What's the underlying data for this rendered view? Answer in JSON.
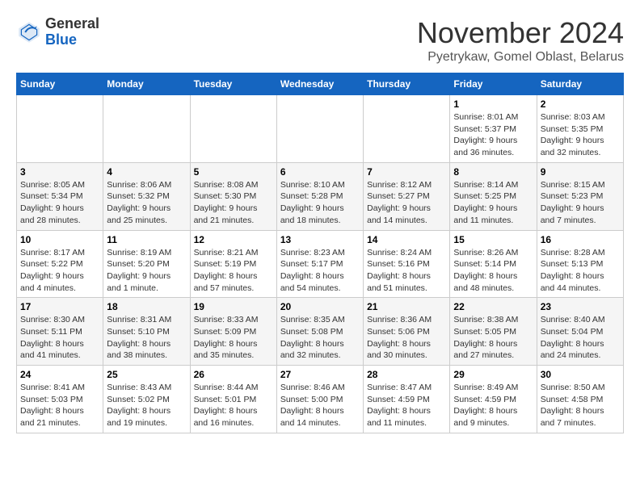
{
  "header": {
    "logo": {
      "line1": "General",
      "line2": "Blue"
    },
    "title": "November 2024",
    "location": "Pyetrykaw, Gomel Oblast, Belarus"
  },
  "weekdays": [
    "Sunday",
    "Monday",
    "Tuesday",
    "Wednesday",
    "Thursday",
    "Friday",
    "Saturday"
  ],
  "weeks": [
    [
      {
        "day": "",
        "info": ""
      },
      {
        "day": "",
        "info": ""
      },
      {
        "day": "",
        "info": ""
      },
      {
        "day": "",
        "info": ""
      },
      {
        "day": "",
        "info": ""
      },
      {
        "day": "1",
        "info": "Sunrise: 8:01 AM\nSunset: 5:37 PM\nDaylight: 9 hours\nand 36 minutes."
      },
      {
        "day": "2",
        "info": "Sunrise: 8:03 AM\nSunset: 5:35 PM\nDaylight: 9 hours\nand 32 minutes."
      }
    ],
    [
      {
        "day": "3",
        "info": "Sunrise: 8:05 AM\nSunset: 5:34 PM\nDaylight: 9 hours\nand 28 minutes."
      },
      {
        "day": "4",
        "info": "Sunrise: 8:06 AM\nSunset: 5:32 PM\nDaylight: 9 hours\nand 25 minutes."
      },
      {
        "day": "5",
        "info": "Sunrise: 8:08 AM\nSunset: 5:30 PM\nDaylight: 9 hours\nand 21 minutes."
      },
      {
        "day": "6",
        "info": "Sunrise: 8:10 AM\nSunset: 5:28 PM\nDaylight: 9 hours\nand 18 minutes."
      },
      {
        "day": "7",
        "info": "Sunrise: 8:12 AM\nSunset: 5:27 PM\nDaylight: 9 hours\nand 14 minutes."
      },
      {
        "day": "8",
        "info": "Sunrise: 8:14 AM\nSunset: 5:25 PM\nDaylight: 9 hours\nand 11 minutes."
      },
      {
        "day": "9",
        "info": "Sunrise: 8:15 AM\nSunset: 5:23 PM\nDaylight: 9 hours\nand 7 minutes."
      }
    ],
    [
      {
        "day": "10",
        "info": "Sunrise: 8:17 AM\nSunset: 5:22 PM\nDaylight: 9 hours\nand 4 minutes."
      },
      {
        "day": "11",
        "info": "Sunrise: 8:19 AM\nSunset: 5:20 PM\nDaylight: 9 hours\nand 1 minute."
      },
      {
        "day": "12",
        "info": "Sunrise: 8:21 AM\nSunset: 5:19 PM\nDaylight: 8 hours\nand 57 minutes."
      },
      {
        "day": "13",
        "info": "Sunrise: 8:23 AM\nSunset: 5:17 PM\nDaylight: 8 hours\nand 54 minutes."
      },
      {
        "day": "14",
        "info": "Sunrise: 8:24 AM\nSunset: 5:16 PM\nDaylight: 8 hours\nand 51 minutes."
      },
      {
        "day": "15",
        "info": "Sunrise: 8:26 AM\nSunset: 5:14 PM\nDaylight: 8 hours\nand 48 minutes."
      },
      {
        "day": "16",
        "info": "Sunrise: 8:28 AM\nSunset: 5:13 PM\nDaylight: 8 hours\nand 44 minutes."
      }
    ],
    [
      {
        "day": "17",
        "info": "Sunrise: 8:30 AM\nSunset: 5:11 PM\nDaylight: 8 hours\nand 41 minutes."
      },
      {
        "day": "18",
        "info": "Sunrise: 8:31 AM\nSunset: 5:10 PM\nDaylight: 8 hours\nand 38 minutes."
      },
      {
        "day": "19",
        "info": "Sunrise: 8:33 AM\nSunset: 5:09 PM\nDaylight: 8 hours\nand 35 minutes."
      },
      {
        "day": "20",
        "info": "Sunrise: 8:35 AM\nSunset: 5:08 PM\nDaylight: 8 hours\nand 32 minutes."
      },
      {
        "day": "21",
        "info": "Sunrise: 8:36 AM\nSunset: 5:06 PM\nDaylight: 8 hours\nand 30 minutes."
      },
      {
        "day": "22",
        "info": "Sunrise: 8:38 AM\nSunset: 5:05 PM\nDaylight: 8 hours\nand 27 minutes."
      },
      {
        "day": "23",
        "info": "Sunrise: 8:40 AM\nSunset: 5:04 PM\nDaylight: 8 hours\nand 24 minutes."
      }
    ],
    [
      {
        "day": "24",
        "info": "Sunrise: 8:41 AM\nSunset: 5:03 PM\nDaylight: 8 hours\nand 21 minutes."
      },
      {
        "day": "25",
        "info": "Sunrise: 8:43 AM\nSunset: 5:02 PM\nDaylight: 8 hours\nand 19 minutes."
      },
      {
        "day": "26",
        "info": "Sunrise: 8:44 AM\nSunset: 5:01 PM\nDaylight: 8 hours\nand 16 minutes."
      },
      {
        "day": "27",
        "info": "Sunrise: 8:46 AM\nSunset: 5:00 PM\nDaylight: 8 hours\nand 14 minutes."
      },
      {
        "day": "28",
        "info": "Sunrise: 8:47 AM\nSunset: 4:59 PM\nDaylight: 8 hours\nand 11 minutes."
      },
      {
        "day": "29",
        "info": "Sunrise: 8:49 AM\nSunset: 4:59 PM\nDaylight: 8 hours\nand 9 minutes."
      },
      {
        "day": "30",
        "info": "Sunrise: 8:50 AM\nSunset: 4:58 PM\nDaylight: 8 hours\nand 7 minutes."
      }
    ]
  ]
}
